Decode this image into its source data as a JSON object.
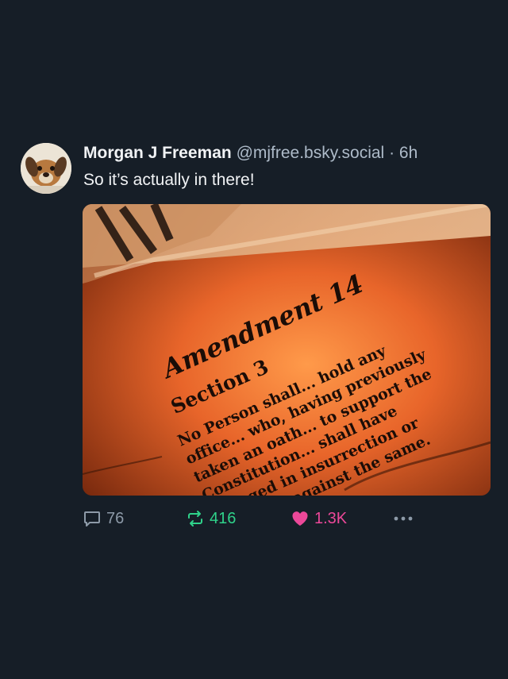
{
  "post": {
    "author_name": "Morgan J Freeman",
    "handle": "@mjfree.bsky.social",
    "separator": "·",
    "time": "6h",
    "text": "So it’s actually in there!"
  },
  "image": {
    "heading": "Amendment 14",
    "section": "Section 3",
    "lines": [
      "No Person shall... hold any",
      "office... who, having previously",
      "taken an oath... to support the",
      "Constitution... shall have",
      "engaged in insurrection or",
      "rebellion against the same."
    ]
  },
  "actions": {
    "replies": "76",
    "reposts": "416",
    "likes": "1.3K"
  },
  "colors": {
    "background": "#161e27",
    "repost": "#2fd28a",
    "like": "#ec4899",
    "muted": "#8d9aa8"
  }
}
